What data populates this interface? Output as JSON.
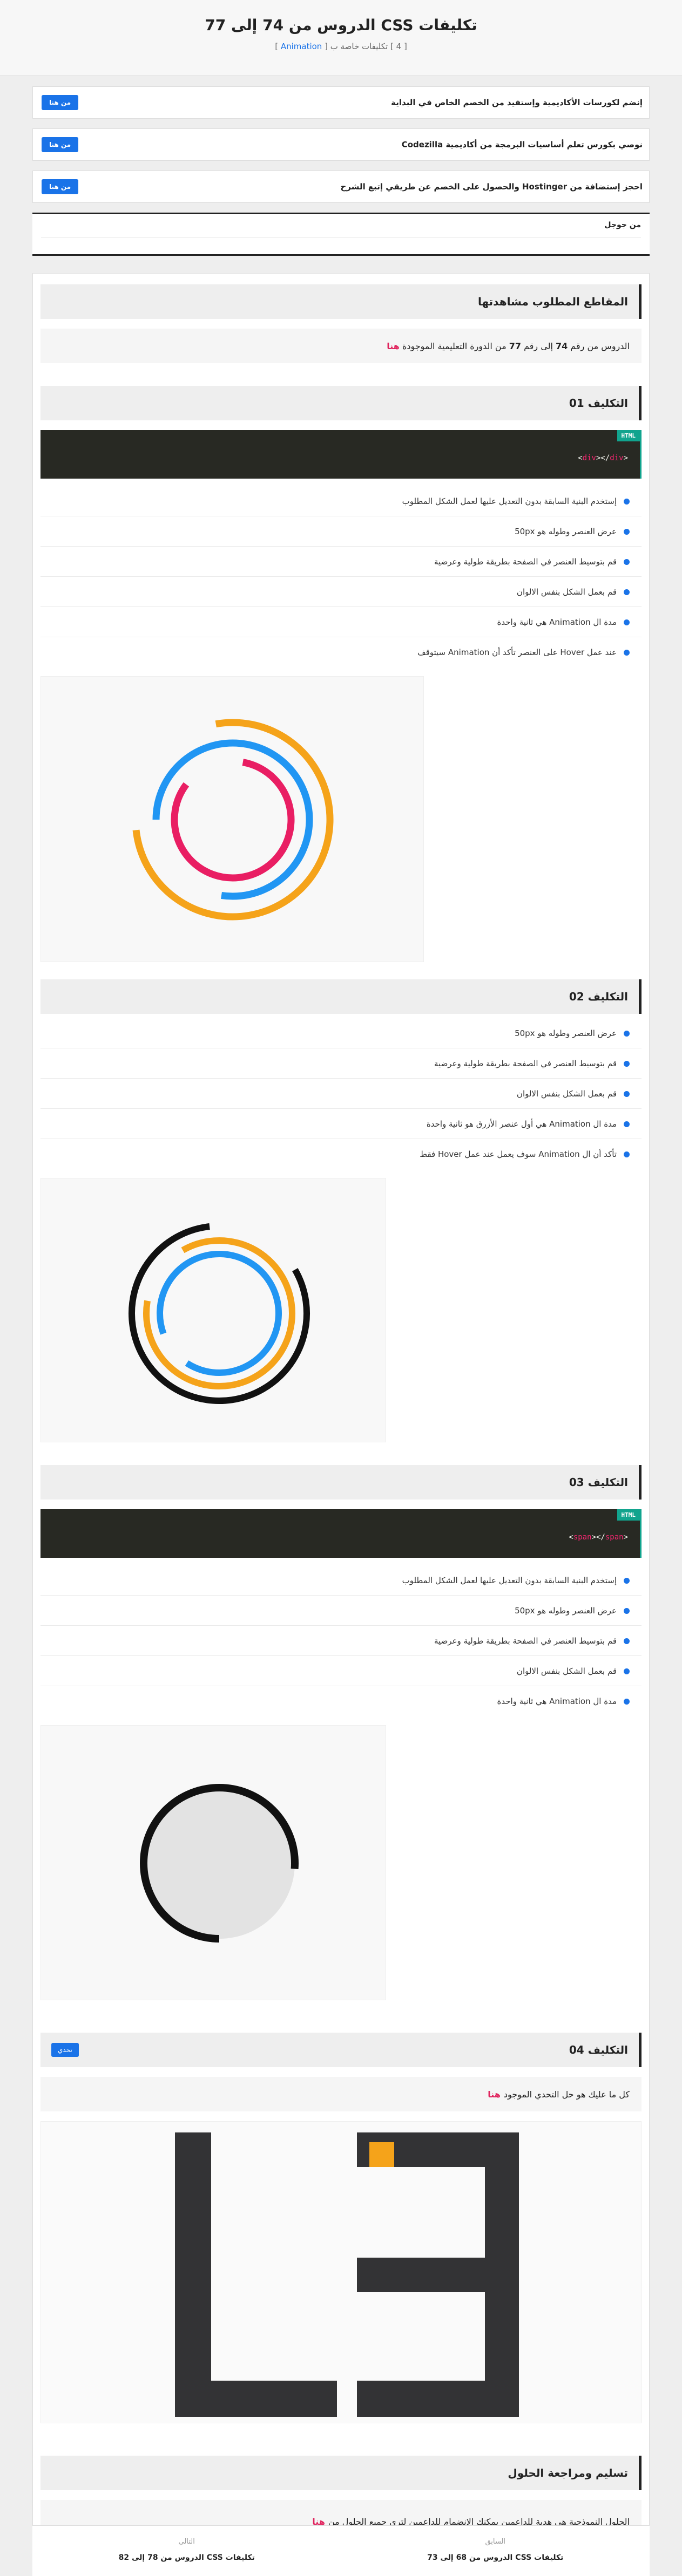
{
  "header": {
    "title": "تكليفات CSS الدروس من 74 إلى 77",
    "subtitle_prefix": "[ 4 ] تكليفات خاصة ب [",
    "subtitle_tag": "Animation",
    "subtitle_suffix": "]"
  },
  "ads": [
    {
      "text": "إنضم لكورسات الأكاديمية وإستفيد من الخصم الخاص في البداية",
      "button": "من هنا"
    },
    {
      "text": "نوصي بكورس تعلم أساسيات البرمجة من أكاديمية Codezilla",
      "button": "من هنا"
    },
    {
      "text": "احجز إستضافة من Hostinger والحصول على الخصم عن طريقي إتبع الشرح",
      "button": "من هنا"
    }
  ],
  "google_box": {
    "label": "من جوجل"
  },
  "videos_section": {
    "title": "المقاطع المطلوب مشاهدتها",
    "text_prefix": "الدروس من رقم",
    "from_num": "74",
    "text_mid": "إلى رقم",
    "to_num": "77",
    "text_suffix": "من الدورة التعليمية الموجودة",
    "link": "هنا"
  },
  "assignment1": {
    "title": "التكليف 01",
    "code_label": "HTML",
    "code_open": "<",
    "code_tag1": "div",
    "code_mid": "></",
    "code_tag2": "div",
    "code_close": ">",
    "tasks": [
      "إستخدم البنية السابقة بدون التعديل عليها لعمل الشكل المطلوب",
      "عرض العنصر وطوله هو 50px",
      "قم بتوسيط العنصر في الصفحة بطريقة طولية وعرضية",
      "قم بعمل الشكل بنفس الالوان",
      "مدة ال Animation هي ثانية واحدة",
      "عند عمل Hover على العنصر تأكد أن Animation سيتوقف"
    ]
  },
  "assignment2": {
    "title": "التكليف 02",
    "tasks": [
      "عرض العنصر وطوله هو 50px",
      "قم بتوسيط العنصر في الصفحة بطريقة طولية وعرضية",
      "قم بعمل الشكل بنفس الالوان",
      "مدة ال Animation هي أول عنصر الأزرق هو ثانية واحدة",
      "تأكد أن ال Animation سوف يعمل عند عمل Hover فقط"
    ]
  },
  "assignment3": {
    "title": "التكليف 03",
    "code_label": "HTML",
    "code_open": "<",
    "code_tag1": "span",
    "code_mid": "></",
    "code_tag2": "span",
    "code_close": ">",
    "tasks": [
      "إستخدم البنية السابقة بدون التعديل عليها لعمل الشكل المطلوب",
      "عرض العنصر وطوله هو 50px",
      "قم بتوسيط العنصر في الصفحة بطريقة طولية وعرضية",
      "قم بعمل الشكل بنفس الالوان",
      "مدة ال Animation هي ثانية واحدة"
    ]
  },
  "assignment4": {
    "title": "التكليف 04",
    "badge": "تحدي",
    "text_prefix": "كل ما عليك هو حل التحدي الموجود",
    "link": "هنا"
  },
  "submission": {
    "title": "تسليم ومراجعة الحلول",
    "text_prefix": "الحلول النموذجية هي هدية للداعمين يمكنك الإنضمام للداعمين لترى جميع الحلول من",
    "link": "هنا"
  },
  "footer_nav": {
    "prev_label": "السابق",
    "prev_title": "تكليفات CSS الدروس من 68 إلى 73",
    "next_label": "التالي",
    "next_title": "تكليفات CSS الدروس من 78 إلى 82"
  },
  "colors": {
    "accent_blue": "#1a73e8",
    "link_red": "#e0245e",
    "ring_orange": "#f5a31a",
    "ring_blue": "#2196f3",
    "ring_pink": "#e91e63",
    "code_bg": "#282923",
    "code_tag_green": "#11a48e"
  }
}
